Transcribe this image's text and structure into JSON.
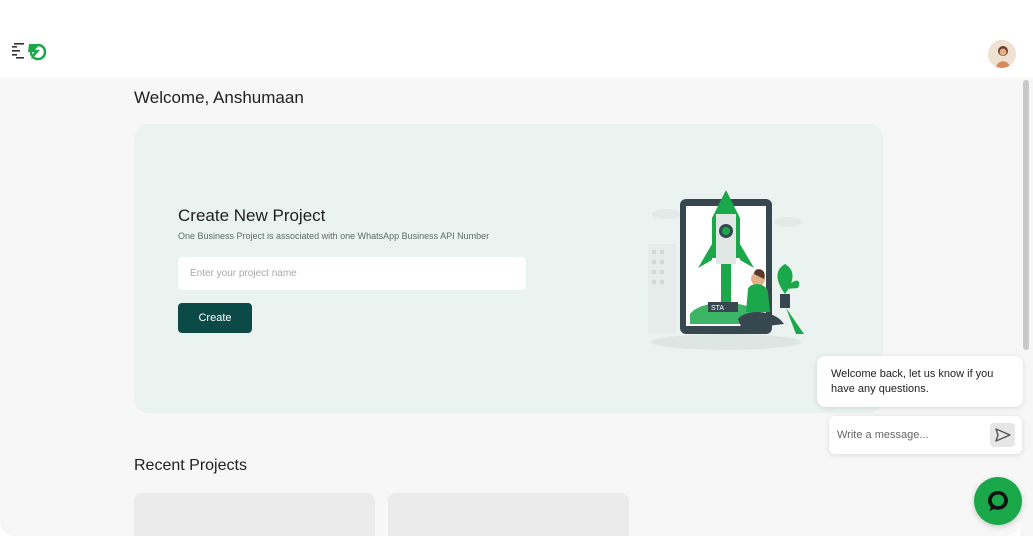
{
  "header": {
    "logo_icon": "lightning-menu-logo-icon",
    "avatar_icon": "user-avatar-icon"
  },
  "main": {
    "welcome_text": "Welcome, Anshumaan",
    "hero": {
      "title": "Create New Project",
      "subtitle": "One Business Project is associated with one WhatsApp Business API Number",
      "input_placeholder": "Enter your project name",
      "input_value": "",
      "create_label": "Create",
      "illustration_start_label": "STA"
    },
    "recent": {
      "title": "Recent Projects",
      "cards": [
        "",
        ""
      ]
    }
  },
  "chat": {
    "welcome_message": "Welcome back, let us know if you have any questions.",
    "input_placeholder": "Write a message...",
    "send_icon": "send-arrow-icon",
    "launcher_icon": "chat-bubble-icon"
  },
  "colors": {
    "brand_green": "#1aa84b",
    "button_dark": "#0c4a47",
    "hero_bg": "#ebf3f1",
    "page_bg": "#f7f7f7"
  }
}
